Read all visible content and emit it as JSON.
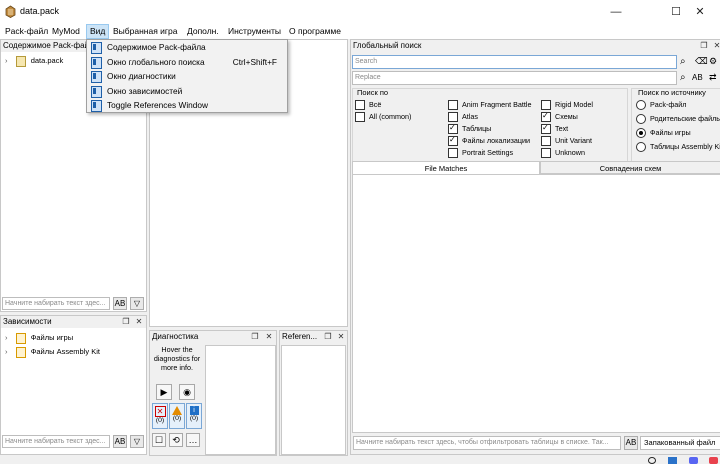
{
  "window": {
    "title": "data.pack",
    "icon": "app-icon",
    "minimize": "—",
    "maximize": "☐",
    "close": "✕"
  },
  "menu": [
    "Pack-файл",
    "MyMod",
    "Вид",
    "Выбранная игра",
    "Дополн.",
    "Инструменты",
    "О программе"
  ],
  "view_menu": {
    "items": [
      {
        "label": "Содержимое Pack-файла",
        "shortcut": ""
      },
      {
        "label": "Окно глобального поиска",
        "shortcut": "Ctrl+Shift+F"
      },
      {
        "label": "Окно диагностики",
        "shortcut": ""
      },
      {
        "label": "Окно зависимостей",
        "shortcut": ""
      },
      {
        "label": "Toggle References Window",
        "shortcut": ""
      }
    ]
  },
  "pack_contents": {
    "title": "Содержимое Pack-файла",
    "tree_item": "data.pack",
    "filter_placeholder": "Начните набирать текст здес...",
    "case_btn": "AB",
    "toggle_btn": "▽"
  },
  "dependencies": {
    "title": "Зависимости",
    "items": [
      "Файлы игры",
      "Файлы Assembly Kit"
    ],
    "filter_placeholder": "Начните набирать текст здес...",
    "case_btn": "AB",
    "toggle_btn": "▽"
  },
  "diagnostics": {
    "title": "Диагностика",
    "hint": "Hover the diagnostics for more info.",
    "counts": {
      "error": "(0)",
      "warning": "(0)",
      "info": "(0)"
    }
  },
  "references": {
    "title": "Referen..."
  },
  "global_search": {
    "title": "Глобальный поиск",
    "search_placeholder": "Search",
    "replace_placeholder": "Replace",
    "search_in_title": "Поиск по",
    "search_in": [
      {
        "label": "Всё",
        "checked": false
      },
      {
        "label": "All (common)",
        "checked": false
      },
      {
        "label": "Anim Fragment Battle",
        "checked": false
      },
      {
        "label": "Atlas",
        "checked": false
      },
      {
        "label": "Таблицы",
        "checked": true
      },
      {
        "label": "Файлы локализации",
        "checked": true
      },
      {
        "label": "Portrait Settings",
        "checked": false
      },
      {
        "label": "Rigid Model",
        "checked": false
      },
      {
        "label": "Схемы",
        "checked": true
      },
      {
        "label": "Text",
        "checked": true
      },
      {
        "label": "Unit Variant",
        "checked": false
      },
      {
        "label": "Unknown",
        "checked": false
      }
    ],
    "source_title": "Поиск по источнику",
    "sources": [
      {
        "label": "Pack-файл",
        "selected": false
      },
      {
        "label": "Родительские файлы",
        "selected": false
      },
      {
        "label": "Файлы игры",
        "selected": true
      },
      {
        "label": "Таблицы Assembly Kit",
        "selected": false
      }
    ],
    "tabs": [
      "File Matches",
      "Совпадения схем"
    ],
    "filter_placeholder": "Начните набирать текст здесь, чтобы отфильтровать таблицы в списке. Так...",
    "case_btn": "AB",
    "source_select": "Запакованный файл"
  }
}
